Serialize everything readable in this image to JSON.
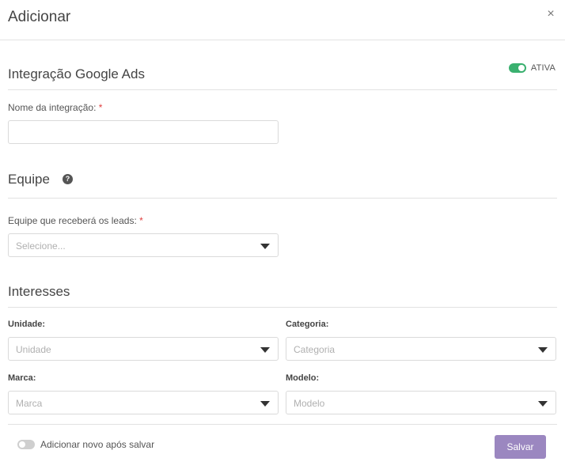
{
  "modal": {
    "title": "Adicionar",
    "close_symbol": "×"
  },
  "integration": {
    "section_title": "Integração Google Ads",
    "status_label": "ATIVA",
    "status_on": true,
    "name_label": "Nome da integração:",
    "required_mark": "*",
    "name_value": ""
  },
  "team": {
    "section_title": "Equipe",
    "help_symbol": "?",
    "field_label": "Equipe que receberá os leads:",
    "required_mark": "*",
    "select_placeholder": "Selecione..."
  },
  "interests": {
    "section_title": "Interesses",
    "unidade_label": "Unidade:",
    "unidade_placeholder": "Unidade",
    "categoria_label": "Categoria:",
    "categoria_placeholder": "Categoria",
    "marca_label": "Marca:",
    "marca_placeholder": "Marca",
    "modelo_label": "Modelo:",
    "modelo_placeholder": "Modelo"
  },
  "footer": {
    "add_new_label": "Adicionar novo após salvar",
    "add_new_on": false,
    "save_label": "Salvar"
  },
  "colors": {
    "toggle_on": "#3ab06f",
    "save_button": "#9b87c0",
    "required": "#e04040"
  }
}
